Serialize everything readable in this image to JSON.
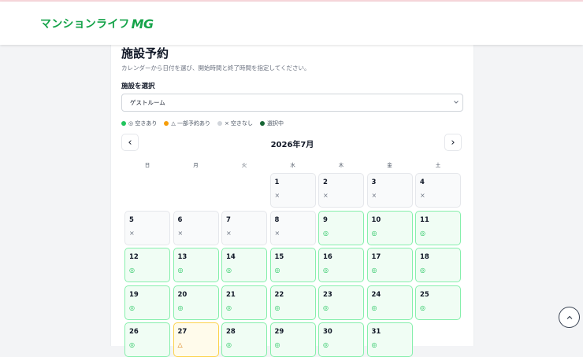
{
  "header": {
    "logo_text": "マンションライフ",
    "logo_mark": "MG"
  },
  "page": {
    "title": "施設予約",
    "description": "カレンダーから日付を選び、開始時間と終了時間を指定してください。",
    "select_label": "施設を選択",
    "facility": {
      "selected": "ゲストルーム"
    }
  },
  "legend": [
    {
      "label": "◎ 空きあり",
      "color": "#22c55e"
    },
    {
      "label": "△ 一部予約あり",
      "color": "#f59e0b"
    },
    {
      "label": "× 空きなし",
      "color": "#d1d5db"
    },
    {
      "label": "選択中",
      "color": "#166534"
    }
  ],
  "calendar": {
    "month_label": "2026年7月",
    "prev_label": "‹",
    "next_label": "›",
    "weekdays": [
      "日",
      "月",
      "火",
      "水",
      "木",
      "金",
      "土"
    ],
    "leading_blanks": 3,
    "days": [
      {
        "num": "1",
        "status": "none",
        "mark": "×"
      },
      {
        "num": "2",
        "status": "none",
        "mark": "×"
      },
      {
        "num": "3",
        "status": "none",
        "mark": "×"
      },
      {
        "num": "4",
        "status": "none",
        "mark": "×"
      },
      {
        "num": "5",
        "status": "none",
        "mark": "×"
      },
      {
        "num": "6",
        "status": "none",
        "mark": "×"
      },
      {
        "num": "7",
        "status": "none",
        "mark": "×"
      },
      {
        "num": "8",
        "status": "none",
        "mark": "×"
      },
      {
        "num": "9",
        "status": "avail",
        "mark": "◎"
      },
      {
        "num": "10",
        "status": "avail",
        "mark": "◎"
      },
      {
        "num": "11",
        "status": "avail",
        "mark": "◎"
      },
      {
        "num": "12",
        "status": "avail",
        "mark": "◎"
      },
      {
        "num": "13",
        "status": "avail",
        "mark": "◎"
      },
      {
        "num": "14",
        "status": "avail",
        "mark": "◎"
      },
      {
        "num": "15",
        "status": "avail",
        "mark": "◎"
      },
      {
        "num": "16",
        "status": "avail",
        "mark": "◎"
      },
      {
        "num": "17",
        "status": "avail",
        "mark": "◎"
      },
      {
        "num": "18",
        "status": "avail",
        "mark": "◎"
      },
      {
        "num": "19",
        "status": "avail",
        "mark": "◎"
      },
      {
        "num": "20",
        "status": "avail",
        "mark": "◎"
      },
      {
        "num": "21",
        "status": "avail",
        "mark": "◎"
      },
      {
        "num": "22",
        "status": "avail",
        "mark": "◎"
      },
      {
        "num": "23",
        "status": "avail",
        "mark": "◎"
      },
      {
        "num": "24",
        "status": "avail",
        "mark": "◎"
      },
      {
        "num": "25",
        "status": "avail",
        "mark": "◎"
      },
      {
        "num": "26",
        "status": "avail",
        "mark": "◎"
      },
      {
        "num": "27",
        "status": "partial",
        "mark": "△"
      },
      {
        "num": "28",
        "status": "avail",
        "mark": "◎"
      },
      {
        "num": "29",
        "status": "avail",
        "mark": "◎"
      },
      {
        "num": "30",
        "status": "avail",
        "mark": "◎"
      },
      {
        "num": "31",
        "status": "avail",
        "mark": "◎"
      }
    ]
  },
  "icons": {
    "select_chevron": "chevron-down-icon",
    "scroll_top": "chevron-up-icon"
  }
}
